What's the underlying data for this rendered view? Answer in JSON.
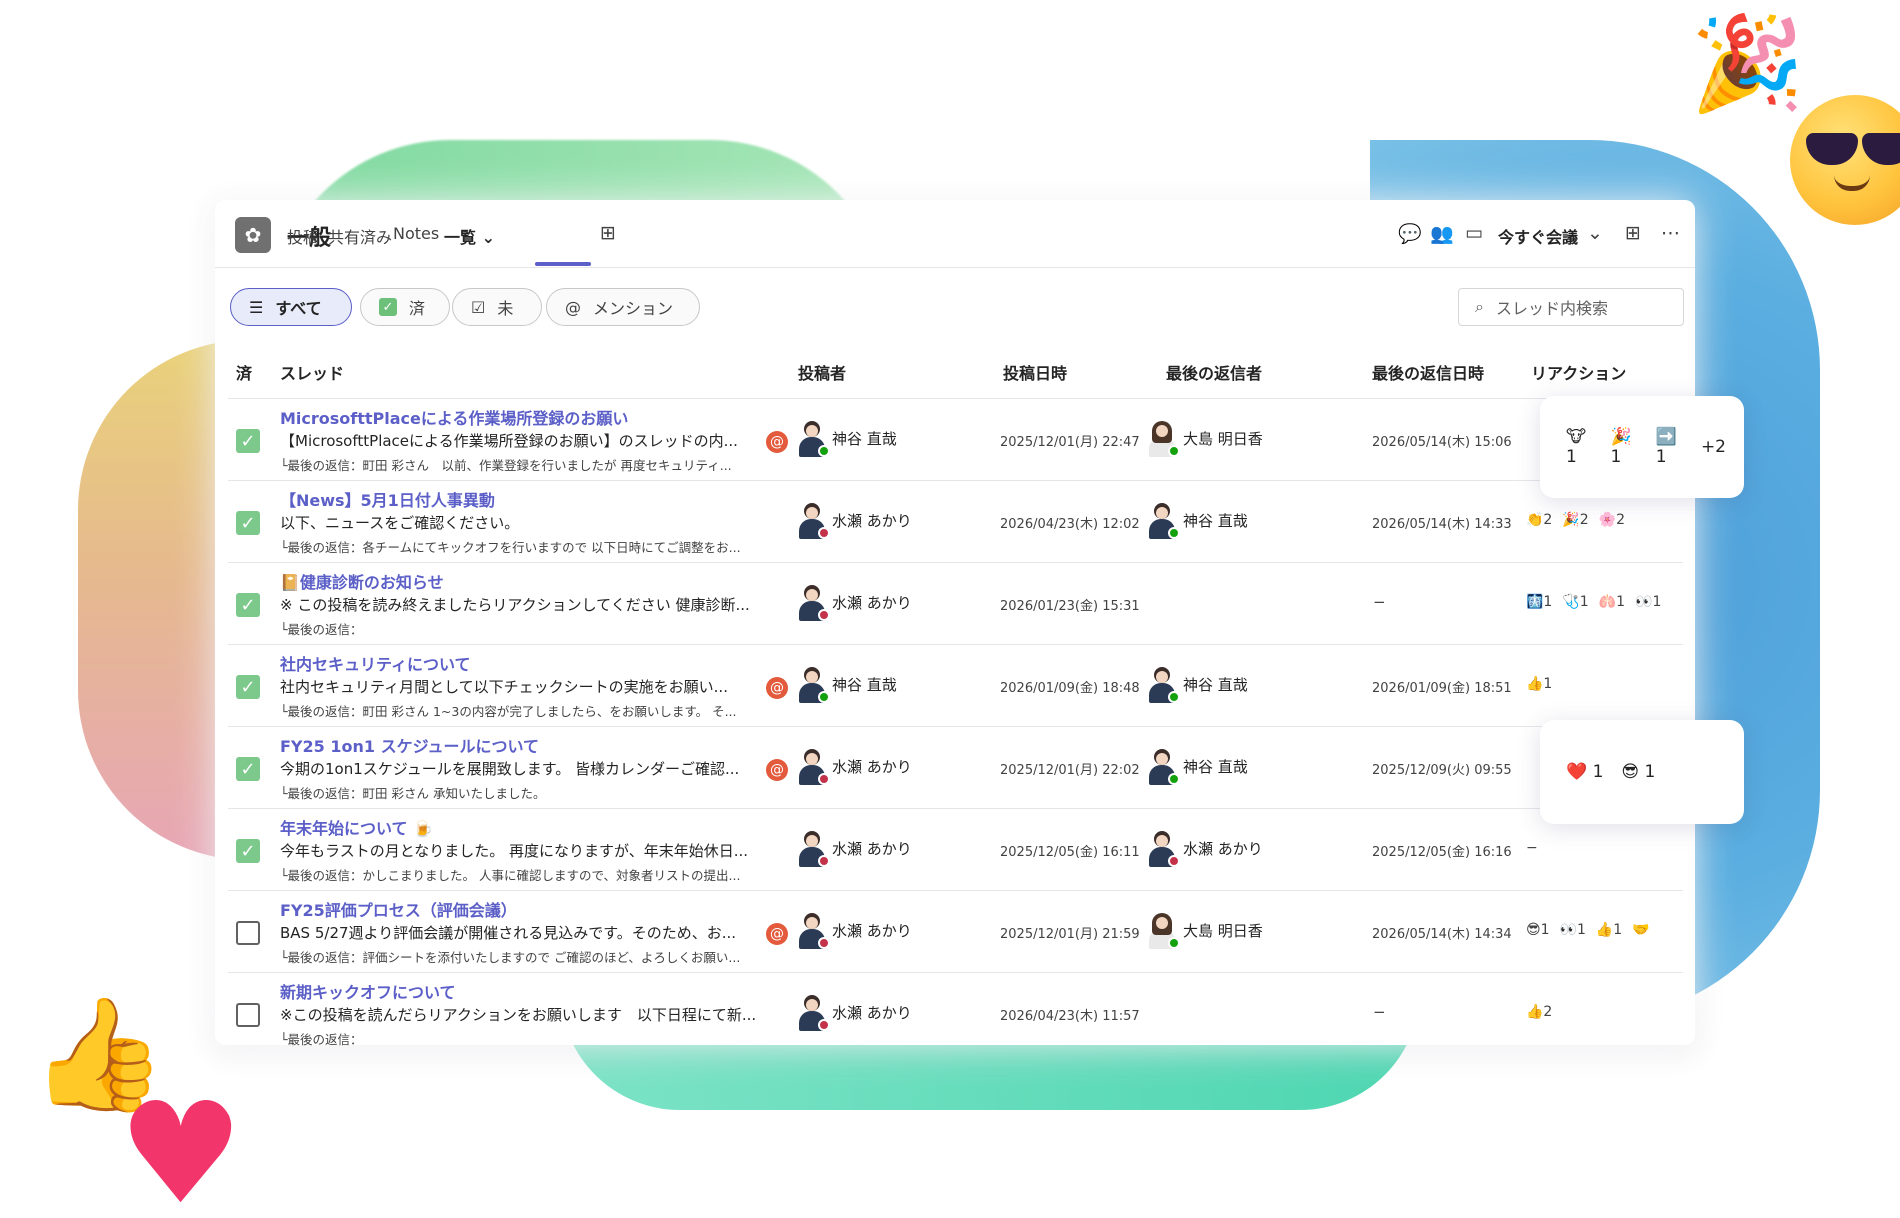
{
  "header": {
    "channel_name": "一般",
    "tabs": [
      "投稿",
      "共有済み",
      "Notes",
      "一覧 ⌄"
    ],
    "meet_label": "今すぐ会議"
  },
  "filters": {
    "all": "すべて",
    "done": "済",
    "undone": "未",
    "mention": "メンション",
    "search_placeholder": "スレッド内検索"
  },
  "columns": [
    "済",
    "スレッド",
    "投稿者",
    "投稿日時",
    "最後の返信者",
    "最後の返信日時",
    "リアクション"
  ],
  "rows": [
    {
      "done": true,
      "title": "MicrosofttPlaceによる作業場所登録のお願い",
      "body": "【MicrosofttPlaceによる作業場所登録のお願い】のスレッドの内...",
      "reply": "└最後の返信：町田 彩さん　以前、作業登録を行いましたが 再度セキュリティ...",
      "mention": true,
      "poster": "神谷 直哉",
      "poster_status": "green",
      "posted": "2025/12/01(月) 22:47",
      "last_replier": "大島 明日香",
      "last_replier_status": "green",
      "last_reply": "2026/05/14(木) 15:06",
      "reactions": []
    },
    {
      "done": true,
      "title": "【News】5月1日付人事異動",
      "body": "以下、ニュースをご確認ください。",
      "reply": "└最後の返信：各チームにてキックオフを行いますので 以下日時にてご調整をお...",
      "mention": false,
      "poster": "水瀬 あかり",
      "poster_status": "red",
      "posted": "2026/04/23(木) 12:02",
      "last_replier": "神谷 直哉",
      "last_replier_status": "green",
      "last_reply": "2026/05/14(木) 14:33",
      "reactions": [
        "👏2",
        "🎉2",
        "🌸2"
      ]
    },
    {
      "done": true,
      "title": "📔健康診断のお知らせ",
      "body": "※ この投稿を読み終えましたらリアクションしてください 健康診断...",
      "reply": "└最後の返信：",
      "mention": false,
      "poster": "水瀬 あかり",
      "poster_status": "red",
      "posted": "2026/01/23(金) 15:31",
      "last_replier": "",
      "last_replier_status": "",
      "last_reply": "−",
      "reactions": [
        "🩻1",
        "🩺1",
        "🫁1",
        "👀1"
      ]
    },
    {
      "done": true,
      "title": "社内セキュリティについて",
      "body": "社内セキュリティ月間として以下チェックシートの実施をお願い...",
      "reply": "└最後の返信：町田 彩さん 1~3の内容が完了しましたら、をお願いします。 そ...",
      "mention": true,
      "poster": "神谷 直哉",
      "poster_status": "green",
      "posted": "2026/01/09(金) 18:48",
      "last_replier": "神谷 直哉",
      "last_replier_status": "green",
      "last_reply": "2026/01/09(金) 18:51",
      "reactions": [
        "👍1"
      ]
    },
    {
      "done": true,
      "title": "FY25 1on1 スケジュールについて",
      "body": "今期の1on1スケジュールを展開致します。 皆様カレンダーご確認...",
      "reply": "└最後の返信：町田 彩さん 承知いたしました。",
      "mention": true,
      "poster": "水瀬 あかり",
      "poster_status": "red",
      "posted": "2025/12/01(月) 22:02",
      "last_replier": "神谷 直哉",
      "last_replier_status": "green",
      "last_reply": "2025/12/09(火) 09:55",
      "reactions": []
    },
    {
      "done": true,
      "title": "年末年始について 🍺",
      "body": "今年もラストの月となりました。 再度になりますが、年末年始休日...",
      "reply": "└最後の返信：かしこまりました。 人事に確認しますので、対象者リストの提出...",
      "mention": false,
      "poster": "水瀬 あかり",
      "poster_status": "red",
      "posted": "2025/12/05(金) 16:11",
      "last_replier": "水瀬 あかり",
      "last_replier_status": "red",
      "last_reply": "2025/12/05(金) 16:16",
      "reactions": [
        "−"
      ]
    },
    {
      "done": false,
      "title": "FY25評価プロセス（評価会議）",
      "body": "BAS 5/27週より評価会議が開催される見込みです。そのため、お...",
      "reply": "└最後の返信：評価シートを添付いたしますので ご確認のほど、よろしくお願い...",
      "mention": true,
      "poster": "水瀬 あかり",
      "poster_status": "red",
      "posted": "2025/12/01(月) 21:59",
      "last_replier": "大島 明日香",
      "last_replier_status": "green",
      "last_reply": "2026/05/14(木) 14:34",
      "reactions": [
        "😎1",
        "👀1",
        "👍1",
        "🤝"
      ]
    },
    {
      "done": false,
      "title": "新期キックオフについて",
      "body": "※この投稿を読んだらリアクションをお願いします　以下日程にて新...",
      "reply": "└最後の返信：",
      "mention": false,
      "poster": "水瀬 あかり",
      "poster_status": "red",
      "posted": "2026/04/23(木) 11:57",
      "last_replier": "",
      "last_replier_status": "",
      "last_reply": "−",
      "reactions": [
        "👍2"
      ]
    }
  ],
  "popovers": [
    {
      "reactions": [
        "🐮 1",
        "🎉 1",
        "➡️ 1",
        "+2"
      ]
    },
    {
      "reactions": [
        "❤️ 1",
        "😎 1"
      ]
    }
  ],
  "colors": {
    "accent": "#5b5fc7",
    "done_check": "#7cc98b",
    "status_available": "#13a10e",
    "status_busy": "#c4314b",
    "mention_badge": "#e35a3d"
  }
}
